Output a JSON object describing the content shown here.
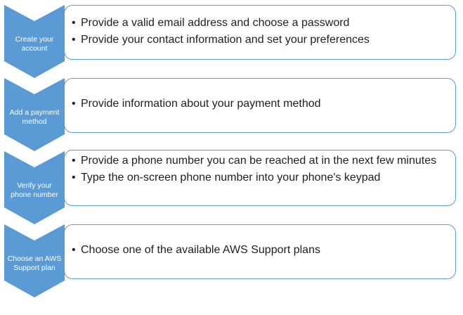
{
  "steps": [
    {
      "label": "Create your account",
      "bullets": [
        "Provide a valid email address and choose a password",
        "Provide your contact information and set your preferences"
      ]
    },
    {
      "label": "Add a payment method",
      "bullets": [
        "Provide information about your payment method"
      ]
    },
    {
      "label": "Verify your phone number",
      "bullets": [
        "Provide a phone number you can be reached at in the next few minutes",
        "Type the on-screen phone number into your phone's keypad"
      ]
    },
    {
      "label": "Choose an AWS Support plan",
      "bullets": [
        "Choose one of the available AWS Support plans"
      ]
    }
  ],
  "colors": {
    "chevron": "#5b9bd5",
    "box_border": "#5b9bd5",
    "text": "#1f1f1f"
  },
  "bullet_glyph": "•"
}
